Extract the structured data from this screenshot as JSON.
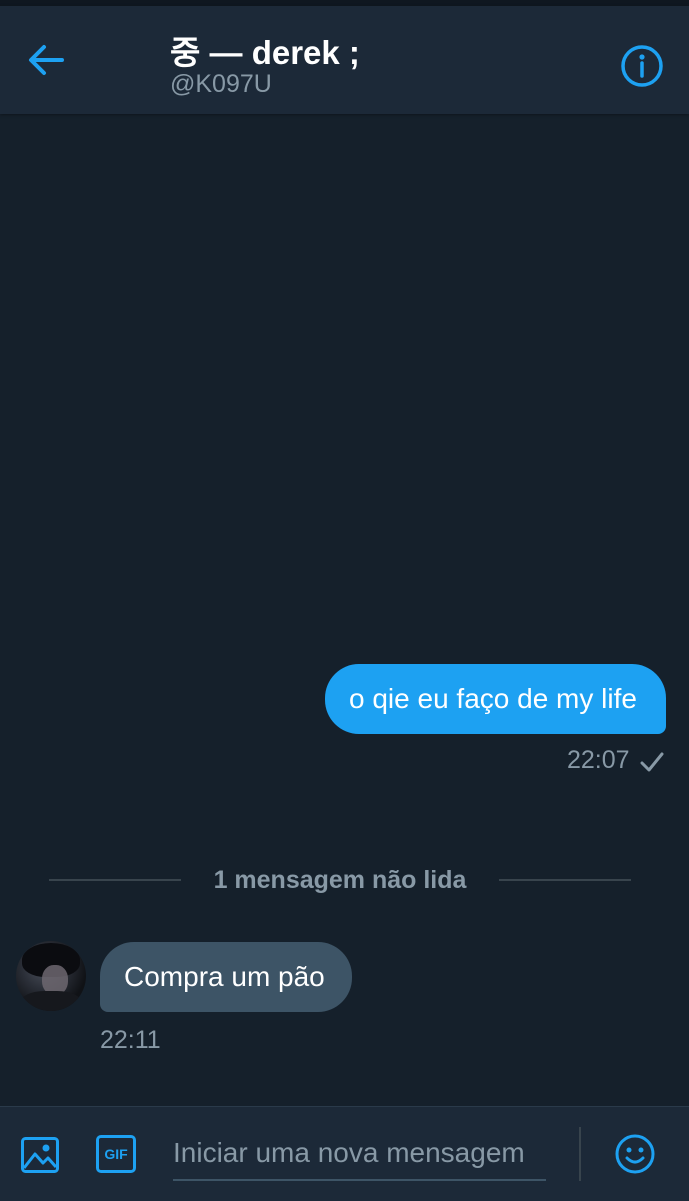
{
  "header": {
    "title": "중 — derek ;",
    "handle": "@K097U",
    "back_icon": "arrow-left-icon",
    "info_icon": "info-circle-icon"
  },
  "messages": {
    "sent": {
      "text": "o qie eu faço de my life",
      "time": "22:07",
      "status_icon": "check-icon"
    },
    "unread_divider": "1 mensagem não lida",
    "received": {
      "text": "Compra um pão",
      "time": "22:11"
    }
  },
  "composer": {
    "placeholder": "Iniciar uma nova mensagem",
    "gif_label": "GIF",
    "image_icon": "image-icon",
    "emoji_icon": "emoji-icon"
  },
  "colors": {
    "background": "#15202b",
    "header": "#1c2938",
    "accent": "#1da1f2",
    "received_bubble": "#3d5466",
    "secondary_text": "#8899a6"
  }
}
